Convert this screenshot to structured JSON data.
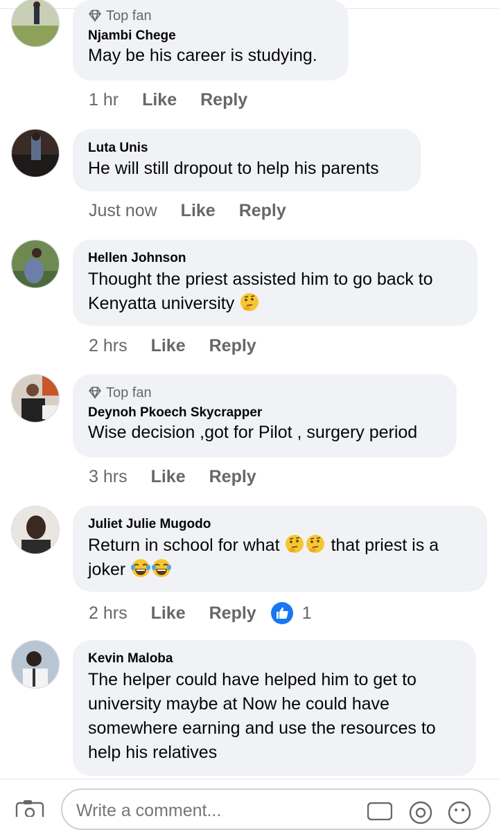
{
  "colors": {
    "bubble": "#f0f2f5",
    "meta": "#65676b",
    "like_blue": "#1877f2",
    "text": "#050505"
  },
  "comments": [
    {
      "badge": "Top fan",
      "author": "Njambi Chege",
      "lines": [
        "May be his career is studying."
      ],
      "time": "1 hr",
      "like": "Like",
      "reply": "Reply"
    },
    {
      "author": "Luta Unis",
      "lines": [
        "He will still dropout to help his parents"
      ],
      "time": "Just now",
      "like": "Like",
      "reply": "Reply"
    },
    {
      "author": "Hellen Johnson",
      "lines": [
        "Thought the priest assisted him to go back to",
        "Kenyatta university"
      ],
      "emoji_after_line2": "thinking-face",
      "time": "2 hrs",
      "like": "Like",
      "reply": "Reply"
    },
    {
      "badge": "Top fan",
      "author": "Deynoh Pkoech Skycrapper",
      "lines": [
        "Wise decision ,got for Pilot , surgery period"
      ],
      "time": "3 hrs",
      "like": "Like",
      "reply": "Reply"
    },
    {
      "author": "Juliet Julie Mugodo",
      "line1_a": "Return in school for what",
      "line1_b": "that priest is a",
      "line2": "joker",
      "time": "2 hrs",
      "like": "Like",
      "reply": "Reply",
      "reaction_icon": "like-reaction-icon",
      "reaction_count": "1"
    },
    {
      "author": "Kevin Maloba",
      "lines": [
        "The helper could have helped him to get to",
        "university maybe at Now he could have",
        "somewhere earning and use the resources to",
        "help his relatives"
      ]
    }
  ],
  "composer": {
    "placeholder": "Write a comment..."
  },
  "icons": [
    "camera-icon",
    "gif-icon",
    "sticker-icon",
    "emoji-icon"
  ]
}
